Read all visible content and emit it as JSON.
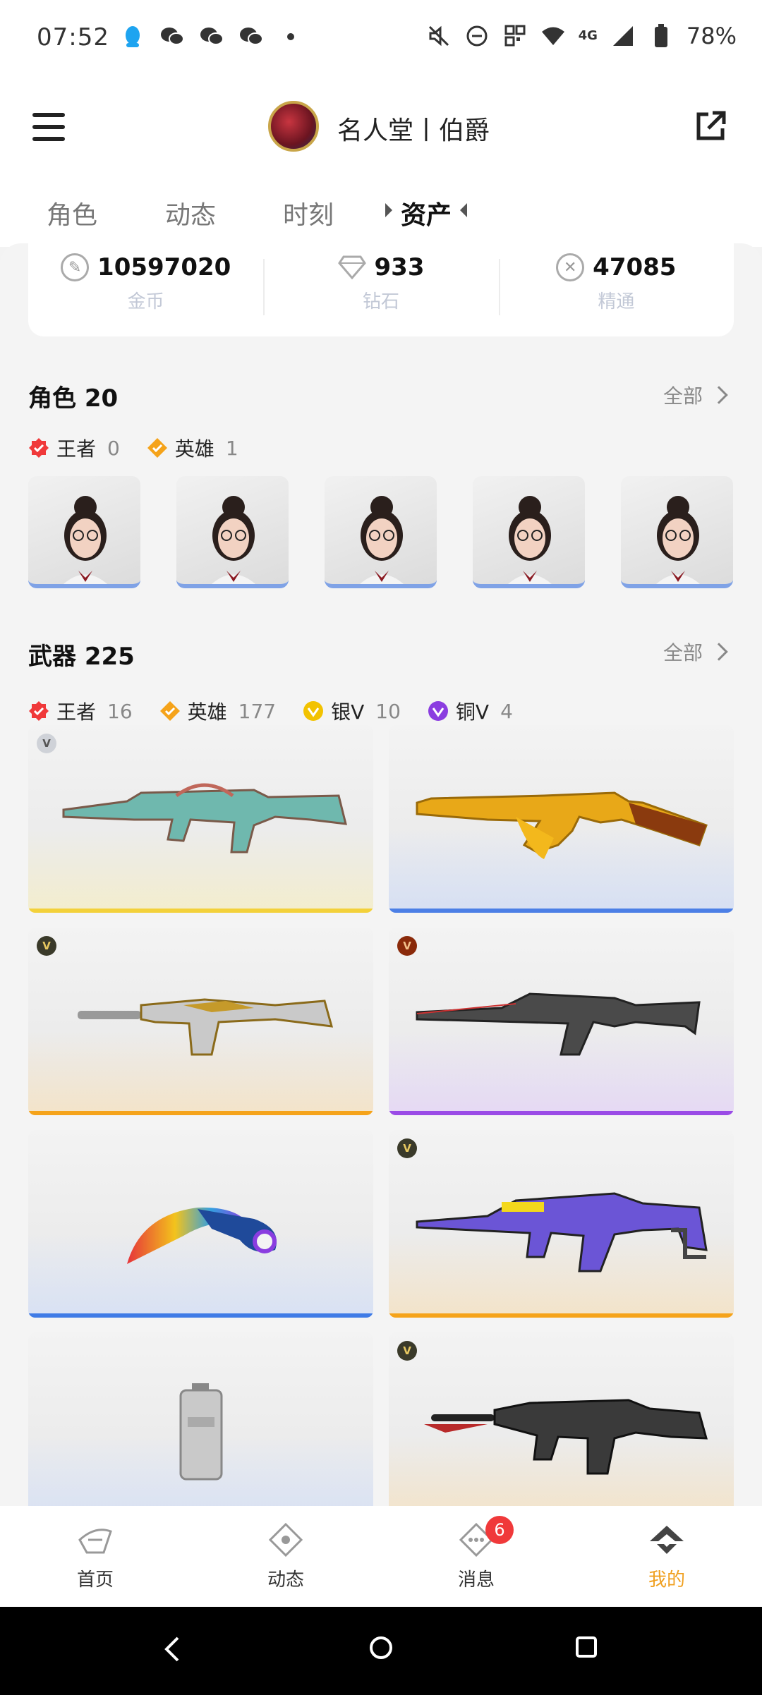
{
  "status_bar": {
    "time": "07:52",
    "battery": "78%",
    "network": "4G",
    "icons_left": [
      "qq-icon",
      "wechat-icon",
      "wechat-icon",
      "wechat-icon",
      "dot-icon"
    ],
    "icons_right": [
      "mute-icon",
      "dnd-icon",
      "nfc-icon",
      "wifi-icon",
      "signal-icon",
      "battery-icon"
    ]
  },
  "header": {
    "title": "名人堂丨伯爵"
  },
  "tabs": [
    {
      "label": "角色"
    },
    {
      "label": "动态"
    },
    {
      "label": "时刻"
    },
    {
      "label": "资产"
    }
  ],
  "currency": [
    {
      "value": "10597020",
      "label": "金币",
      "icon": "coin-icon"
    },
    {
      "value": "933",
      "label": "钻石",
      "icon": "diamond-icon"
    },
    {
      "value": "47085",
      "label": "精通",
      "icon": "mastery-icon"
    }
  ],
  "characters": {
    "title": "角色 20",
    "see_all": "全部",
    "tiers": [
      {
        "name": "王者",
        "count": "0",
        "color": "#f0393a"
      },
      {
        "name": "英雄",
        "count": "1",
        "color": "#f5a31a"
      }
    ],
    "cards": 5
  },
  "weapons": {
    "title": "武器 225",
    "see_all": "全部",
    "tiers": [
      {
        "name": "王者",
        "count": "16",
        "color": "#f0393a"
      },
      {
        "name": "英雄",
        "count": "177",
        "color": "#f5a31a"
      },
      {
        "name": "银V",
        "count": "10",
        "color": "#f2c200"
      },
      {
        "name": "铜V",
        "count": "4",
        "color": "#8b3de0"
      }
    ]
  },
  "colors": {
    "accent_active": "#f0a020",
    "badge_red": "#f0393a"
  },
  "bottom_nav": [
    {
      "label": "首页"
    },
    {
      "label": "动态"
    },
    {
      "label": "消息",
      "badge": "6"
    },
    {
      "label": "我的"
    }
  ]
}
